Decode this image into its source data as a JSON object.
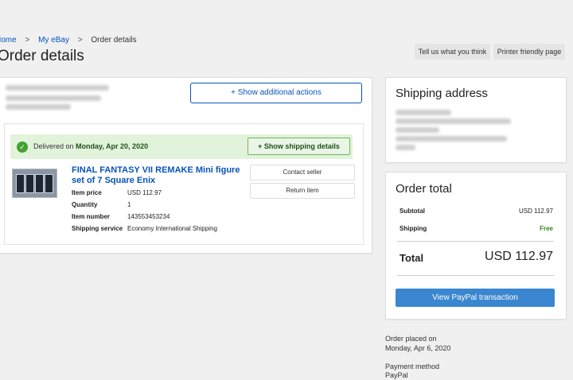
{
  "breadcrumb": {
    "home": "Home",
    "my_ebay": "My eBay",
    "current": "Order details",
    "separator": ">"
  },
  "page_title": "Order details",
  "top_actions": {
    "tell_us": "Tell us what you think",
    "printer_friendly": "Printer friendly page"
  },
  "order_card": {
    "show_actions_label": "+ Show additional actions",
    "delivery": {
      "prefix": "Delivered on",
      "date": "Monday, Apr 20, 2020",
      "show_shipping_label": "+ Show shipping details"
    },
    "item": {
      "title": "FINAL FANTASY VII REMAKE Mini figure set of 7 Square Enix",
      "fields": {
        "price_label": "Item price",
        "price_value": "USD 112.97",
        "qty_label": "Quantity",
        "qty_value": "1",
        "number_label": "Item number",
        "number_value": "143553453234",
        "service_label": "Shipping service",
        "service_value": "Economy International Shipping"
      },
      "contact_seller": "Contact seller",
      "return_item": "Return item"
    }
  },
  "shipping_address": {
    "title": "Shipping address"
  },
  "order_total": {
    "title": "Order total",
    "subtotal_label": "Subtotal",
    "subtotal_value": "USD 112.97",
    "shipping_label": "Shipping",
    "shipping_value": "Free",
    "total_label": "Total",
    "total_value": "USD 112.97",
    "paypal_button": "View PayPal transaction"
  },
  "order_meta": {
    "placed_label": "Order placed on",
    "placed_value": "Monday, Apr 6, 2020",
    "payment_label": "Payment method",
    "payment_value": "PayPal"
  },
  "colors": {
    "link": "#0654ba",
    "delivered_bg": "#e2f3dc",
    "check": "#42a12f",
    "paypal_button": "#3a86d0",
    "free": "#2f8a18"
  }
}
